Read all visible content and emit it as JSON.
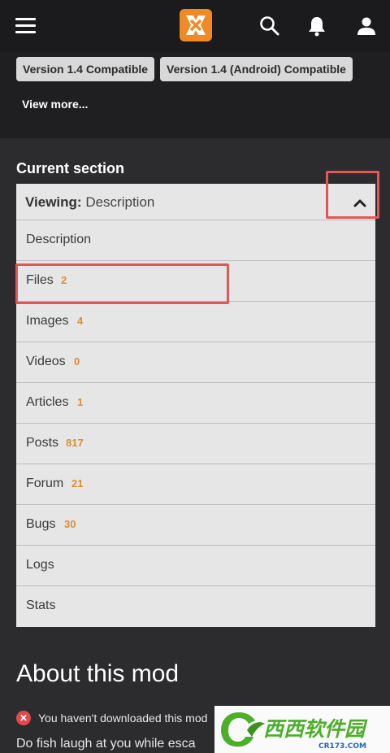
{
  "topbar": {
    "menu_icon": "hamburger-icon",
    "logo_icon": "nexus-logo-icon",
    "search_icon": "search-icon",
    "notifications_icon": "bell-icon",
    "account_icon": "user-icon"
  },
  "compat_tags": [
    "Version 1.4 Compatible",
    "Version 1.4 (Android) Compatible"
  ],
  "view_more_label": "View more...",
  "current_section": {
    "heading": "Current section",
    "viewing_label": "Viewing:",
    "viewing_value": "Description",
    "toggle_icon": "chevron-up-icon",
    "items": [
      {
        "label": "Description",
        "count": ""
      },
      {
        "label": "Files",
        "count": "2"
      },
      {
        "label": "Images",
        "count": "4"
      },
      {
        "label": "Videos",
        "count": "0"
      },
      {
        "label": "Articles",
        "count": "1"
      },
      {
        "label": "Posts",
        "count": "817"
      },
      {
        "label": "Forum",
        "count": "21"
      },
      {
        "label": "Bugs",
        "count": "30"
      },
      {
        "label": "Logs",
        "count": ""
      },
      {
        "label": "Stats",
        "count": ""
      }
    ]
  },
  "about": {
    "title": "About this mod",
    "warning_text": "You haven't downloaded this mod",
    "description_start": "Do fish laugh at you while esca"
  },
  "watermark": {
    "text": "西西软件园",
    "sub_text": "CR173.COM"
  },
  "colors": {
    "topbar_bg": "#1b1b1d",
    "page_bg": "#2c2c2e",
    "count_accent": "#d98f33",
    "highlight_red": "#e35656",
    "watermark_green": "#4caf2a",
    "watermark_blue": "#1e63c8"
  }
}
